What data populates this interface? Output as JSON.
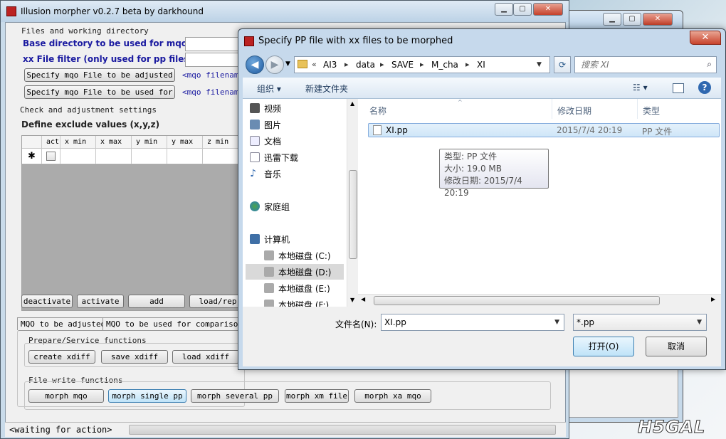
{
  "main_window": {
    "title": "Illusion morpher v0.2.7 beta by darkhound",
    "files_group": "Files and working directory",
    "base_dir_label": "Base directory to be used  for mqo files",
    "xx_filter_label": "xx File filter (only used for pp files)",
    "specify_mqo_btn": "Specify mqo File to be adjusted",
    "specify_mqo_hint": "<mqo filename>",
    "specify_mqo_compare_btn": "Specify mqo File to be used for",
    "specify_mqo_compare_hint": "<mqo filename>",
    "check_group": "Check and adjustment settings",
    "exclude_title": "Define exclude values (x,y,z)",
    "grid_columns": [
      "act",
      "x min",
      "x max",
      "y min",
      "y max",
      "z min"
    ],
    "grid_new_row_marker": "✱",
    "grid_buttons": [
      "deactivate",
      "activate",
      "add",
      "load/rep"
    ],
    "tabs": [
      "MQO to be adjusted",
      "MQO to be used for comparison"
    ],
    "prepare_group": "Prepare/Service functions",
    "prepare_buttons": [
      "create xdiff",
      "save xdiff",
      "load xdiff"
    ],
    "write_group": "File write functions",
    "write_buttons": [
      "morph mqo",
      "morph single pp",
      "morph several pp",
      "morph xm file",
      "morph xa mqo"
    ],
    "status": "<waiting for action>",
    "controls": [
      "▁",
      "▢",
      "✕"
    ]
  },
  "dialog": {
    "title": "Specify PP file with xx files to be morphed",
    "close": "✕",
    "back": "◀",
    "forward": "▶",
    "breadcrumb": [
      "AI3",
      "data",
      "SAVE",
      "M_cha",
      "XI"
    ],
    "breadcrumb_prefix": "«",
    "search_placeholder": "搜索 XI",
    "toolbar": {
      "organize": "组织 ▾",
      "new_folder": "新建文件夹"
    },
    "nav_items": [
      "视频",
      "图片",
      "文档",
      "迅雷下载",
      "音乐",
      "家庭组",
      "计算机",
      "本地磁盘 (C:)",
      "本地磁盘 (D:)",
      "本地磁盘 (E:)",
      "本地磁盘 (F:)"
    ],
    "columns": [
      "名称",
      "修改日期",
      "类型"
    ],
    "file": {
      "name": "XI.pp",
      "date": "2015/7/4 20:19",
      "type": "PP 文件"
    },
    "tooltip": [
      "类型: PP 文件",
      "大小: 19.0 MB",
      "修改日期: 2015/7/4 20:19"
    ],
    "filename_label": "文件名(N):",
    "filename_value": "XI.pp",
    "filter_value": "*.pp",
    "open_btn": "打开(O)",
    "cancel_btn": "取消"
  },
  "watermark": "H5GAL"
}
